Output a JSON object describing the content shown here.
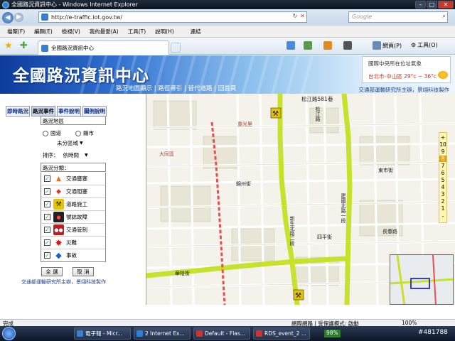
{
  "window": {
    "title": "全國路況資訊中心 - Windows Internet Explorer",
    "minimize": "–",
    "maximize": "□",
    "close": "✕"
  },
  "addressbar": {
    "url": "http://e-traffic.iot.gov.tw/",
    "search_placeholder": "Google",
    "back": "◀",
    "forward": "▶"
  },
  "menu": [
    "檔案(F)",
    "編輯(E)",
    "檢視(V)",
    "我的最愛(A)",
    "工具(T)",
    "說明(H)",
    "連結"
  ],
  "tab": {
    "label": "全國路況資訊中心"
  },
  "commands": {
    "page": "網頁(P)",
    "tools": "工具(O)"
  },
  "banner": {
    "title": "全國路況資訊中心",
    "links": "路況地圖顯示 | 路徑導引 | 替代道路 | 回首頁",
    "weather_line1": "國際中央所在位址氣象",
    "weather_line2": "台北市-中山區 29°c ~ 36°c",
    "credit": "交通部運輸研究所主辦，景翊科技製作"
  },
  "leftpanel": {
    "tabs": [
      "即時路況",
      "路況事件",
      "事件說明",
      "圖例說明"
    ],
    "area_label": "路況地區",
    "radio_road": "國道",
    "radio_city": "縣市",
    "district_select": "未分區域",
    "sort_label": "排序：",
    "sort_select": "依時間",
    "category_label": "路況分類：",
    "categories": [
      {
        "label": "交通壅塞",
        "icon": "cone-icon",
        "color": "#e07020"
      },
      {
        "label": "交通阻塞",
        "icon": "barrier-icon",
        "color": "#d83a2a"
      },
      {
        "label": "道路施工",
        "icon": "construction-icon",
        "color": "#444444"
      },
      {
        "label": "號誌故障",
        "icon": "traffic-light-icon",
        "color": "#222222"
      },
      {
        "label": "交通管制",
        "icon": "control-icon",
        "color": "#b52020"
      },
      {
        "label": "災難",
        "icon": "disaster-icon",
        "color": "#d01818"
      },
      {
        "label": "事故",
        "icon": "accident-icon",
        "color": "#1a60c8"
      }
    ],
    "select_all": "全 選",
    "cancel": "取 消",
    "credit": "交通部運輸研究所主辦，景翊科技製作"
  },
  "map": {
    "road_labels": [
      "松江路",
      "松江路581巷",
      "東市街",
      "錦州街",
      "四平街",
      "長春路",
      "新生北路二段",
      "建國北路一段",
      "林森北路",
      "錦西街",
      "吉林路",
      "松江路",
      "華陰街",
      "大同區",
      "重光里"
    ],
    "scale_levels": [
      "+",
      "10",
      "9",
      "8",
      "7",
      "6",
      "5",
      "4",
      "3",
      "2",
      "1",
      "-"
    ],
    "scale_selected": "8"
  },
  "statusbar": {
    "left": "完成",
    "zone": "網際網路 | 受保護模式: 啟動",
    "zoom": "100%"
  },
  "taskbar": {
    "items": [
      "電子報 - Micr...",
      "2 Internet Ex...",
      "Default - Flas...",
      "RDS_event_2 ..."
    ],
    "battery": "98%",
    "clock": "#481788"
  }
}
